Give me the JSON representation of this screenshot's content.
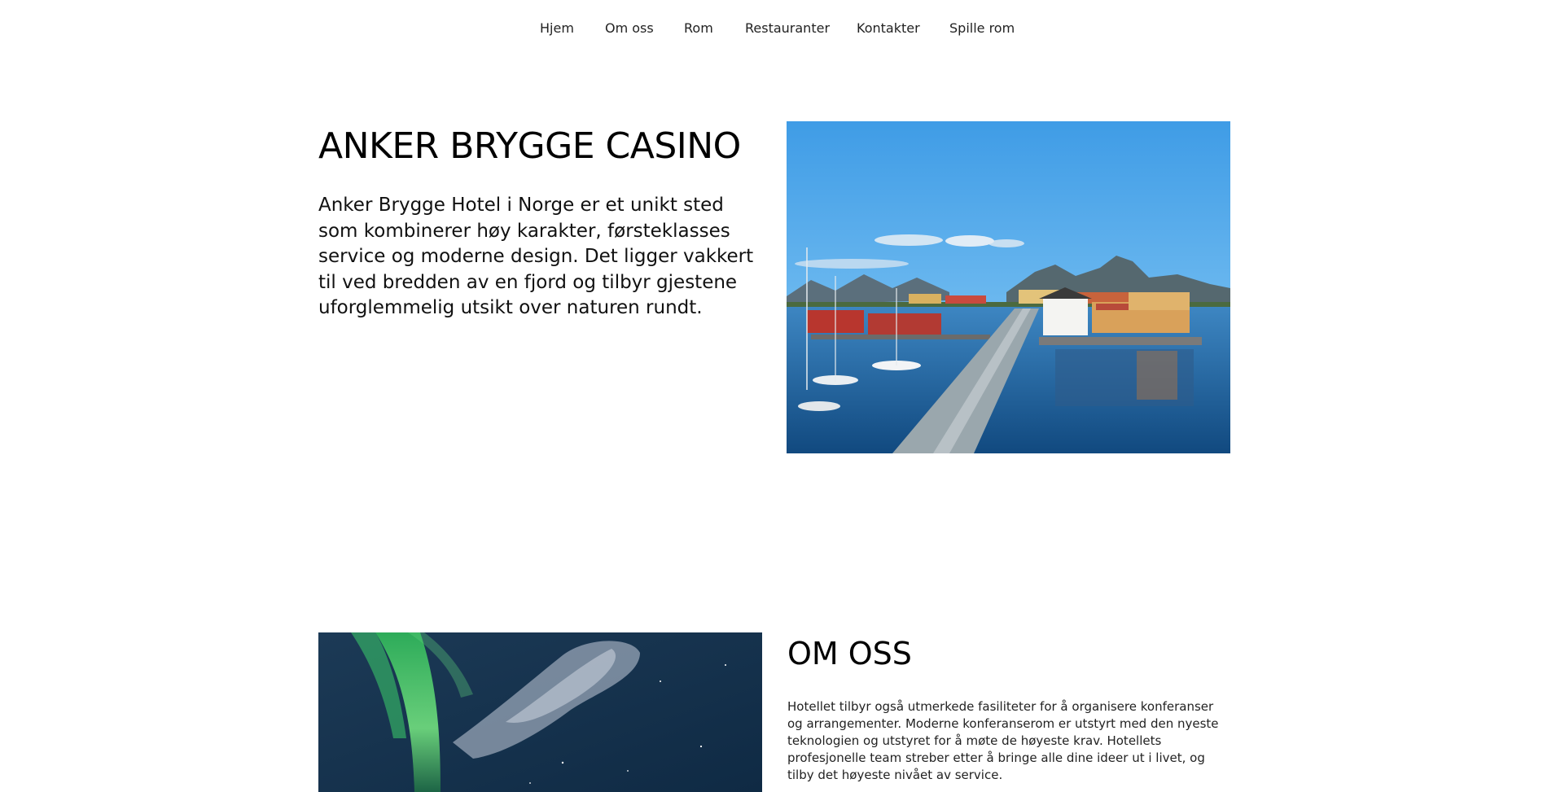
{
  "nav": {
    "items": [
      {
        "label": "Hjem"
      },
      {
        "label": "Om oss"
      },
      {
        "label": "Rom"
      },
      {
        "label": "Restauranter"
      },
      {
        "label": "Kontakter"
      },
      {
        "label": "Spille rom"
      }
    ]
  },
  "hero": {
    "title": "ANKER BRYGGE CASINO",
    "text": "Anker Brygge Hotel i Norge er et unikt sted som kombinerer høy karakter, førsteklasses service og moderne design. Det ligger vakkert til ved bredden av en fjord og tilbyr gjestene uforglemmelig utsikt over naturen rundt."
  },
  "about": {
    "title": "OM OSS",
    "text": "Hotellet tilbyr også utmerkede fasiliteter for å organisere konferanser og arrangementer. Moderne konferanserom er utstyrt med den nyeste teknologien og utstyret for å møte de høyeste krav. Hotellets profesjonelle team streber etter å bringe alle dine ideer ut i livet, og tilby det høyeste nivået av service."
  }
}
